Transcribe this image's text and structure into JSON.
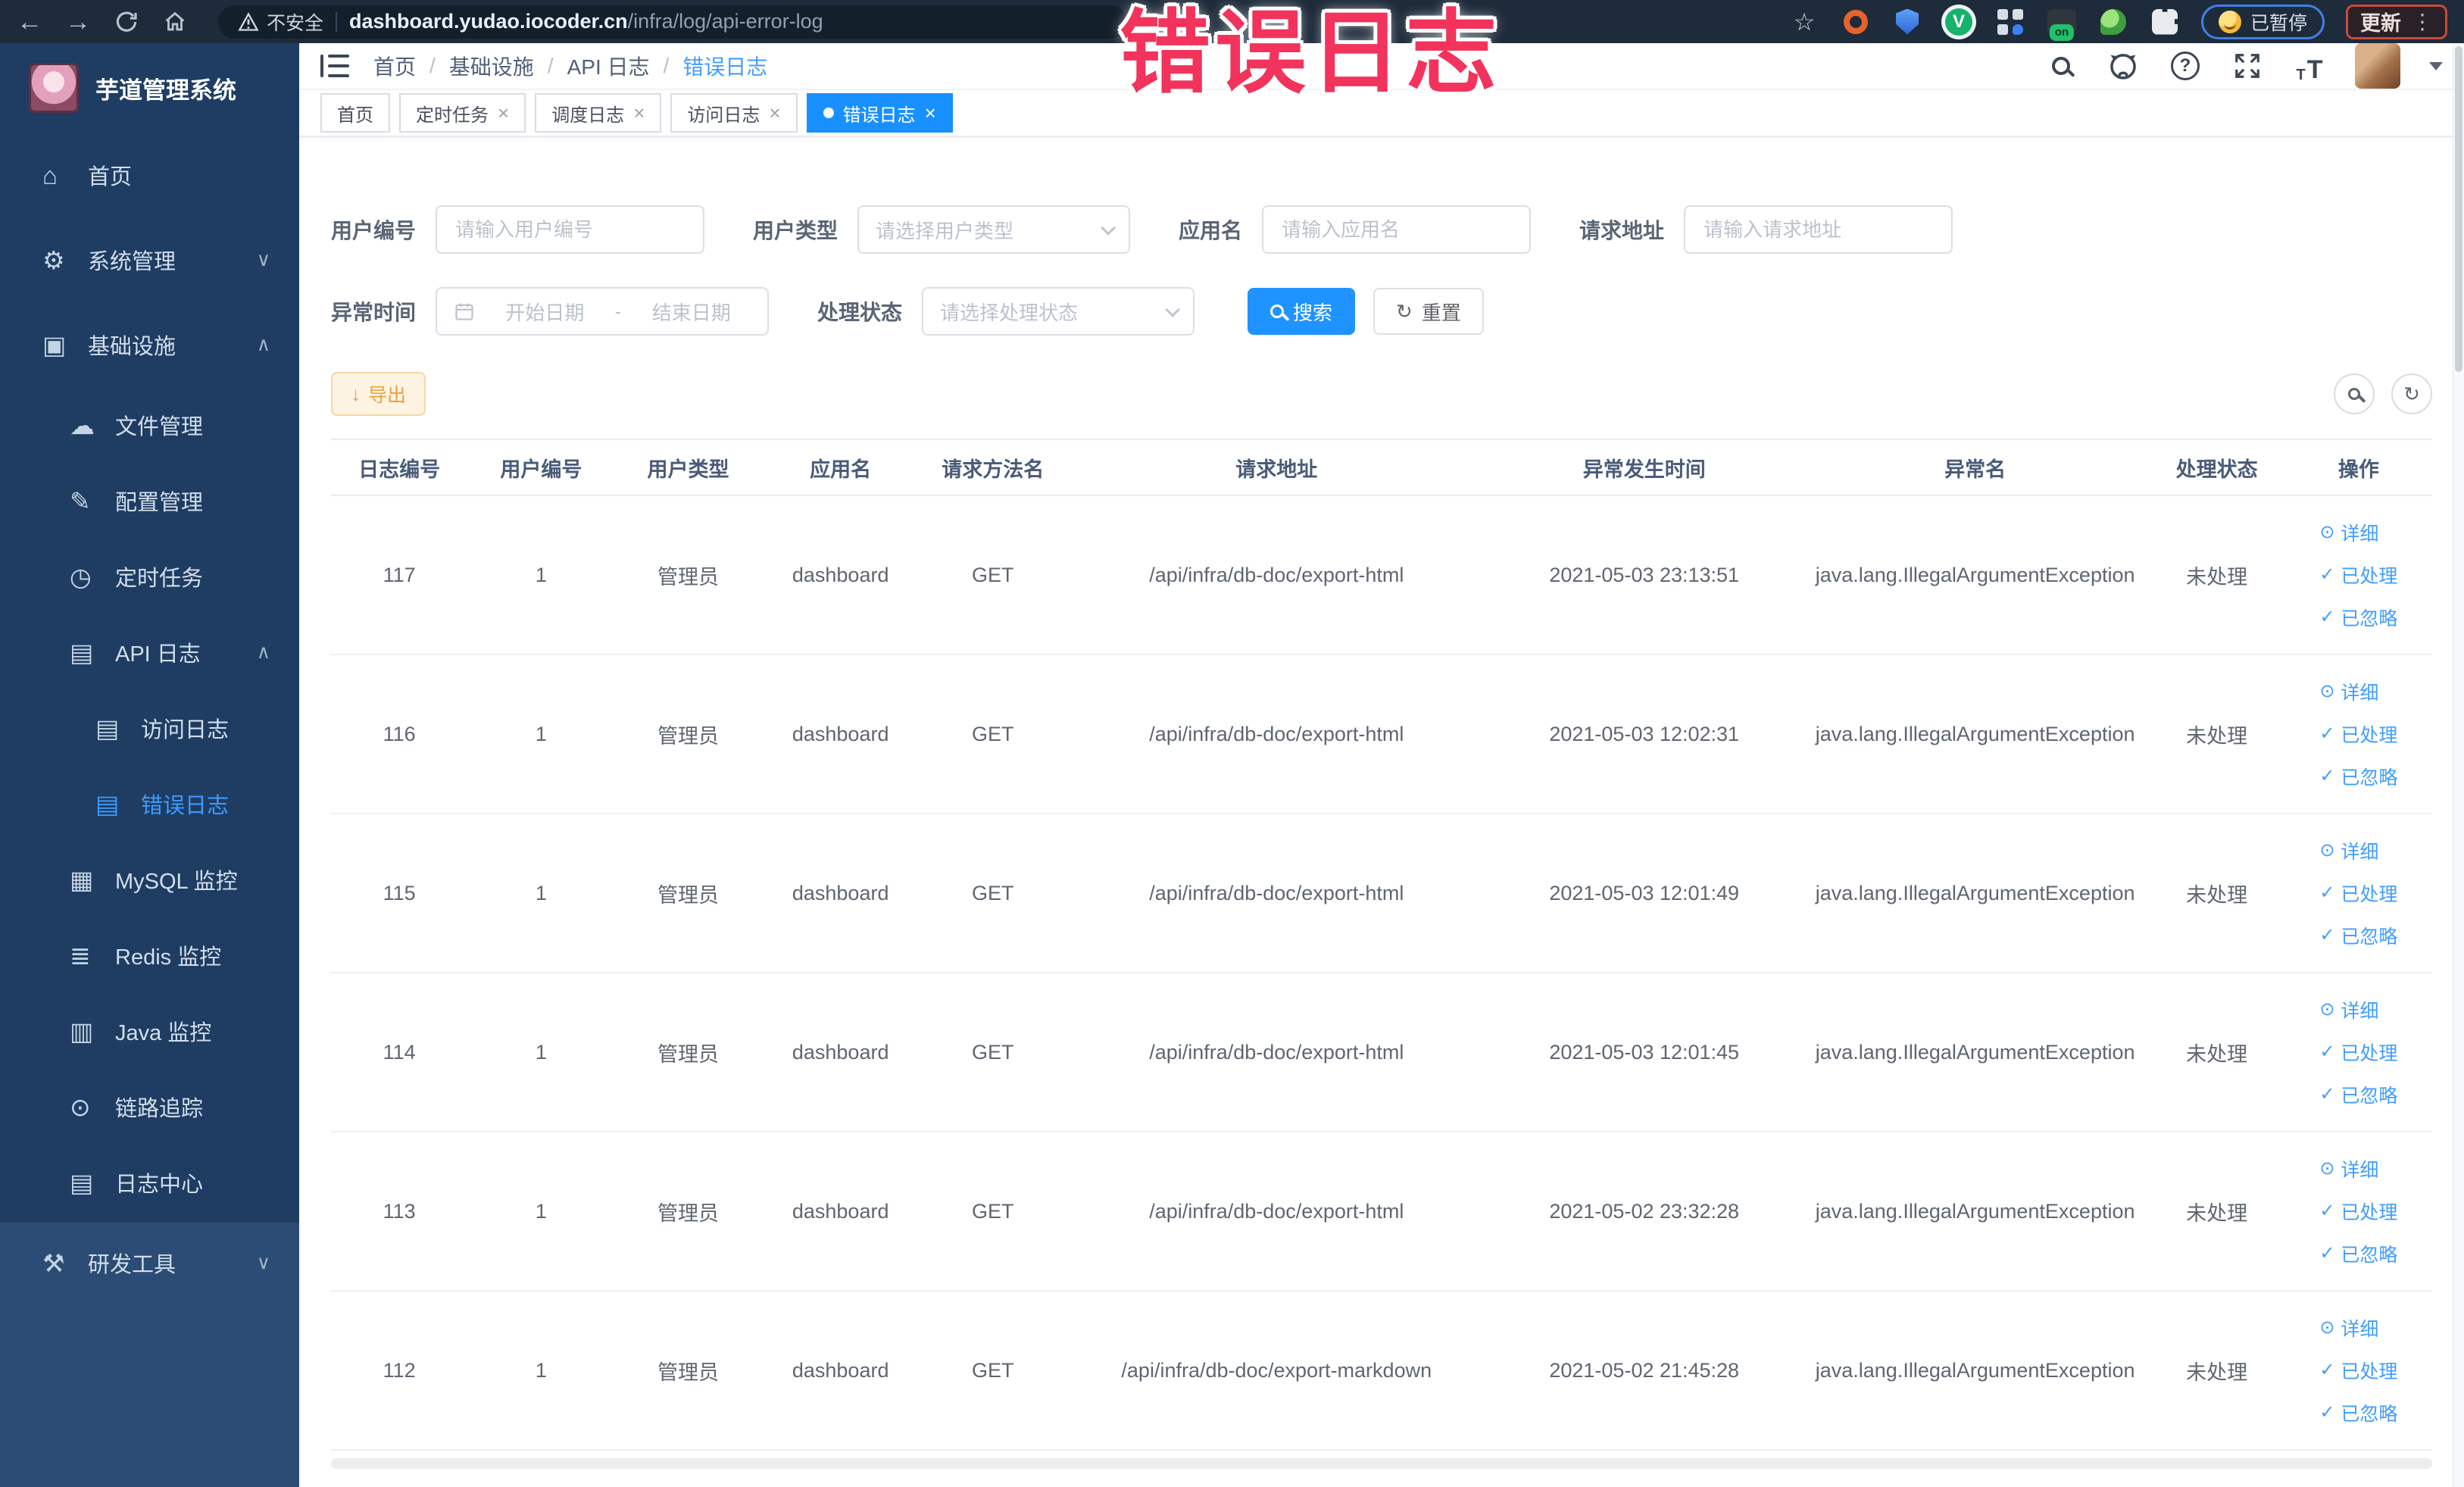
{
  "browser": {
    "security_warning": "不安全",
    "url_domain": "dashboard.yudao.iocoder.cn",
    "url_path": "/infra/log/api-error-log",
    "paused_label": "已暂停",
    "update_label": "更新",
    "menu_dots": "⋮"
  },
  "annotation": {
    "text": "错误日志"
  },
  "sidebar": {
    "title": "芋道管理系统",
    "items": [
      {
        "label": "首页",
        "icon": "home-icon",
        "arrow": "",
        "level": 0,
        "active": false
      },
      {
        "label": "系统管理",
        "icon": "gear-icon",
        "arrow": "chevron-down-icon",
        "level": 0,
        "active": false
      },
      {
        "label": "基础设施",
        "icon": "monitor-icon",
        "arrow": "chevron-up-icon",
        "level": 0,
        "active": false
      },
      {
        "label": "文件管理",
        "icon": "cloud-icon",
        "arrow": "",
        "level": 1,
        "active": false
      },
      {
        "label": "配置管理",
        "icon": "edit-icon",
        "arrow": "",
        "level": 1,
        "active": false
      },
      {
        "label": "定时任务",
        "icon": "timer-icon",
        "arrow": "",
        "level": 1,
        "active": false
      },
      {
        "label": "API 日志",
        "icon": "doc-icon",
        "arrow": "chevron-up-icon",
        "level": 1,
        "active": false
      },
      {
        "label": "访问日志",
        "icon": "doc-icon",
        "arrow": "",
        "level": 2,
        "active": false
      },
      {
        "label": "错误日志",
        "icon": "doc-icon",
        "arrow": "",
        "level": 2,
        "active": true
      },
      {
        "label": "MySQL 监控",
        "icon": "chart-icon",
        "arrow": "",
        "level": 1,
        "active": false
      },
      {
        "label": "Redis 监控",
        "icon": "layers-icon",
        "arrow": "",
        "level": 1,
        "active": false
      },
      {
        "label": "Java 监控",
        "icon": "screen-icon",
        "arrow": "",
        "level": 1,
        "active": false
      },
      {
        "label": "链路追踪",
        "icon": "eye-icon",
        "arrow": "",
        "level": 1,
        "active": false
      },
      {
        "label": "日志中心",
        "icon": "doc-icon",
        "arrow": "",
        "level": 1,
        "active": false
      }
    ],
    "dev_tools": {
      "label": "研发工具",
      "icon": "tool-icon",
      "arrow": "chevron-down-icon"
    }
  },
  "breadcrumb": [
    {
      "label": "首页",
      "active": false
    },
    {
      "label": "基础设施",
      "active": false
    },
    {
      "label": "API 日志",
      "active": false
    },
    {
      "label": "错误日志",
      "active": true
    }
  ],
  "tabs": [
    {
      "label": "首页",
      "closable": false,
      "active": false
    },
    {
      "label": "定时任务",
      "closable": true,
      "active": false
    },
    {
      "label": "调度日志",
      "closable": true,
      "active": false
    },
    {
      "label": "访问日志",
      "closable": true,
      "active": false
    },
    {
      "label": "错误日志",
      "closable": true,
      "active": true
    }
  ],
  "filters": {
    "user_id": {
      "label": "用户编号",
      "placeholder": "请输入用户编号"
    },
    "user_type": {
      "label": "用户类型",
      "placeholder": "请选择用户类型"
    },
    "app_name": {
      "label": "应用名",
      "placeholder": "请输入应用名"
    },
    "request_url": {
      "label": "请求地址",
      "placeholder": "请输入请求地址"
    },
    "exception_time": {
      "label": "异常时间",
      "start_placeholder": "开始日期",
      "separator": "-",
      "end_placeholder": "结束日期"
    },
    "process_status": {
      "label": "处理状态",
      "placeholder": "请选择处理状态"
    },
    "search_button": "搜索",
    "reset_button": "重置"
  },
  "toolbar": {
    "export_button": "导出"
  },
  "table": {
    "headers": [
      "日志编号",
      "用户编号",
      "用户类型",
      "应用名",
      "请求方法名",
      "请求地址",
      "异常发生时间",
      "异常名",
      "处理状态",
      "操作"
    ],
    "actions": [
      {
        "icon": "eye-icon",
        "label": "详细"
      },
      {
        "icon": "check-icon",
        "label": "已处理"
      },
      {
        "icon": "check-icon",
        "label": "已忽略"
      }
    ],
    "rows": [
      {
        "log_id": "117",
        "user_id": "1",
        "user_type": "管理员",
        "app_name": "dashboard",
        "method": "GET",
        "url": "/api/infra/db-doc/export-html",
        "time": "2021-05-03 23:13:51",
        "exception": "java.lang.IllegalArgumentException",
        "status": "未处理"
      },
      {
        "log_id": "116",
        "user_id": "1",
        "user_type": "管理员",
        "app_name": "dashboard",
        "method": "GET",
        "url": "/api/infra/db-doc/export-html",
        "time": "2021-05-03 12:02:31",
        "exception": "java.lang.IllegalArgumentException",
        "status": "未处理"
      },
      {
        "log_id": "115",
        "user_id": "1",
        "user_type": "管理员",
        "app_name": "dashboard",
        "method": "GET",
        "url": "/api/infra/db-doc/export-html",
        "time": "2021-05-03 12:01:49",
        "exception": "java.lang.IllegalArgumentException",
        "status": "未处理"
      },
      {
        "log_id": "114",
        "user_id": "1",
        "user_type": "管理员",
        "app_name": "dashboard",
        "method": "GET",
        "url": "/api/infra/db-doc/export-html",
        "time": "2021-05-03 12:01:45",
        "exception": "java.lang.IllegalArgumentException",
        "status": "未处理"
      },
      {
        "log_id": "113",
        "user_id": "1",
        "user_type": "管理员",
        "app_name": "dashboard",
        "method": "GET",
        "url": "/api/infra/db-doc/export-html",
        "time": "2021-05-02 23:32:28",
        "exception": "java.lang.IllegalArgumentException",
        "status": "未处理"
      },
      {
        "log_id": "112",
        "user_id": "1",
        "user_type": "管理员",
        "app_name": "dashboard",
        "method": "GET",
        "url": "/api/infra/db-doc/export-markdown",
        "time": "2021-05-02 21:45:28",
        "exception": "java.lang.IllegalArgumentException",
        "status": "未处理"
      }
    ]
  },
  "icons": {
    "home-icon": "⌂",
    "gear-icon": "⚙",
    "monitor-icon": "▣",
    "cloud-icon": "☁",
    "edit-icon": "✎",
    "timer-icon": "◷",
    "doc-icon": "▤",
    "chart-icon": "▦",
    "layers-icon": "≣",
    "screen-icon": "▥",
    "eye-icon": "⊙",
    "tool-icon": "⚒",
    "chevron-down-icon": "∨",
    "chevron-up-icon": "∧",
    "check-icon": "✓",
    "download-icon": "↓",
    "refresh-icon": "↻",
    "star-icon": "☆",
    "back-icon": "←",
    "forward-icon": "→",
    "close-icon": "×"
  }
}
